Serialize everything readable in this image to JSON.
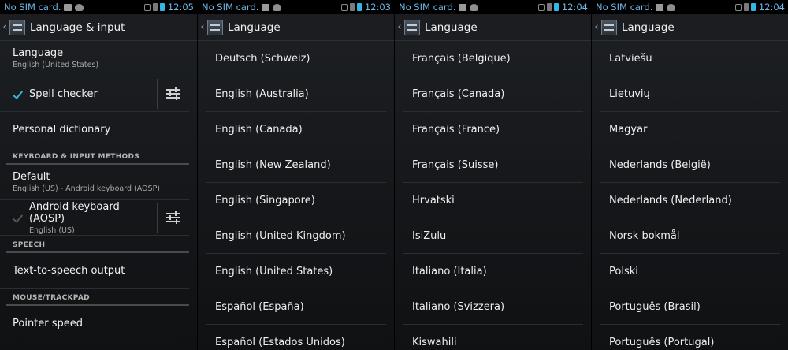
{
  "status_bar": {
    "carrier": "No SIM card.",
    "accent_color": "#33b5e5"
  },
  "screens": [
    {
      "clock": "12:05",
      "title": "Language & input",
      "language": {
        "title": "Language",
        "summary": "English (United States)"
      },
      "spell_checker": {
        "title": "Spell checker",
        "checked": true
      },
      "personal_dictionary": "Personal dictionary",
      "section_keyboard": "KEYBOARD & INPUT METHODS",
      "default": {
        "title": "Default",
        "summary": "English (US) - Android keyboard (AOSP)"
      },
      "android_keyboard": {
        "title": "Android keyboard (AOSP)",
        "summary": "English (US)"
      },
      "section_speech": "SPEECH",
      "tts": "Text-to-speech output",
      "section_mouse": "MOUSE/TRACKPAD",
      "pointer_speed": "Pointer speed"
    },
    {
      "clock": "12:03",
      "title": "Language",
      "items": [
        "Deutsch (Schweiz)",
        "English (Australia)",
        "English (Canada)",
        "English (New Zealand)",
        "English (Singapore)",
        "English (United Kingdom)",
        "English (United States)",
        "Español (España)",
        "Español (Estados Unidos)"
      ]
    },
    {
      "clock": "12:04",
      "title": "Language",
      "items": [
        "Français (Belgique)",
        "Français (Canada)",
        "Français (France)",
        "Français (Suisse)",
        "Hrvatski",
        "IsiZulu",
        "Italiano (Italia)",
        "Italiano (Svizzera)",
        "Kiswahili"
      ]
    },
    {
      "clock": "12:04",
      "title": "Language",
      "items": [
        "Latviešu",
        "Lietuvių",
        "Magyar",
        "Nederlands (België)",
        "Nederlands (Nederland)",
        "Norsk bokmål",
        "Polski",
        "Português (Brasil)",
        "Português (Portugal)"
      ]
    }
  ]
}
